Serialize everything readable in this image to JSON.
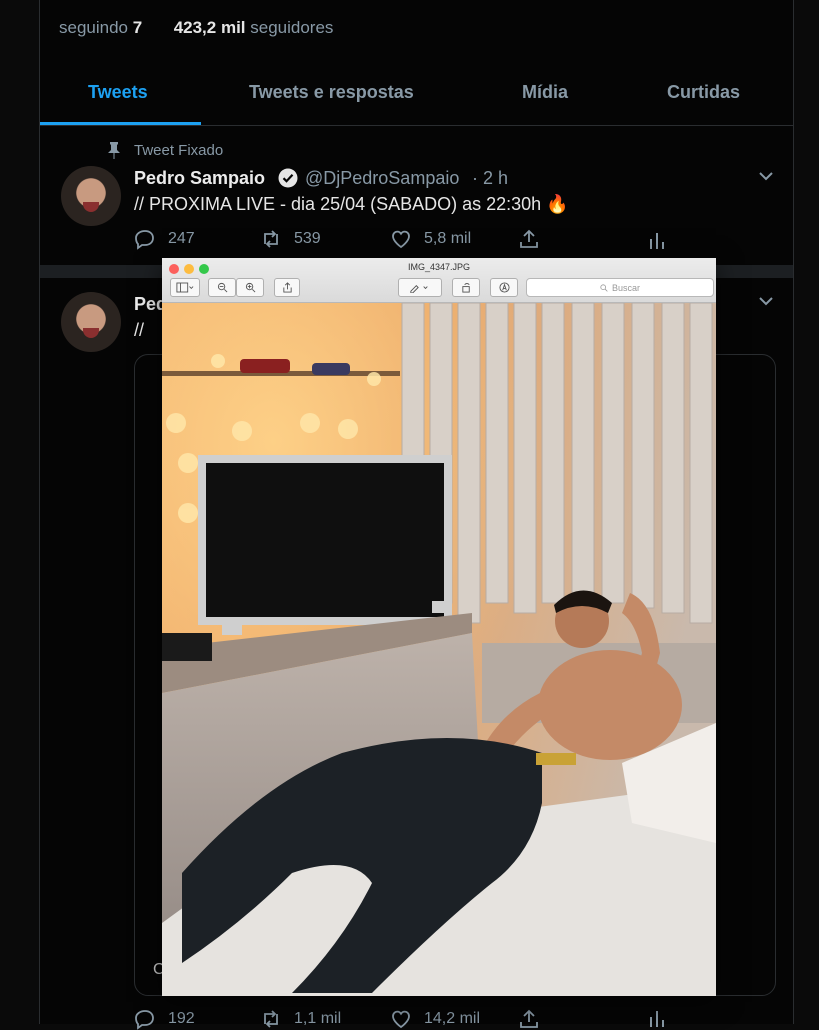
{
  "profile": {
    "following_label": "seguindo",
    "following_count": "7",
    "followers_count": "423,2 mil",
    "followers_label": "seguidores"
  },
  "tabs": [
    {
      "label": "Tweets",
      "active": true
    },
    {
      "label": "Tweets e respostas",
      "active": false
    },
    {
      "label": "Mídia",
      "active": false
    },
    {
      "label": "Curtidas",
      "active": false
    }
  ],
  "pinned_tweet": {
    "pinned_label": "Tweet Fixado",
    "name": "Pedro Sampaio",
    "handle": "@DjPedroSampaio",
    "time": "· 2 h",
    "text": "// PROXIMA LIVE - dia 25/04 (SABADO) as 22:30h 🔥",
    "replies": "247",
    "retweets": "539",
    "likes": "5,8 mil"
  },
  "second_tweet": {
    "name": "Pedro",
    "text": "//",
    "media_caption": "C",
    "replies": "192",
    "retweets": "1,1 mil",
    "likes": "14,2 mil"
  },
  "preview_window": {
    "title": "IMG_4347.JPG",
    "search_placeholder": "Buscar"
  },
  "colors": {
    "accent": "#1da1f2",
    "muted": "#8899a6",
    "background": "#050505"
  }
}
